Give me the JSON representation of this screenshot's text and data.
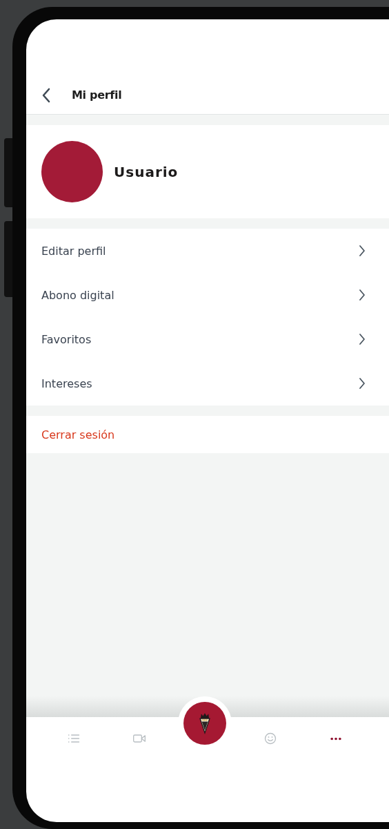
{
  "header": {
    "title": "Mi perfil"
  },
  "profile": {
    "name": "Usuario"
  },
  "menu": [
    {
      "label": "Editar perfil"
    },
    {
      "label": "Abono digital"
    },
    {
      "label": "Favoritos"
    },
    {
      "label": "Intereses"
    }
  ],
  "logout": {
    "label": "Cerrar sesión"
  },
  "bottom_nav": [
    {
      "kind": "list",
      "selected": false
    },
    {
      "kind": "video",
      "selected": false
    },
    {
      "kind": "crest",
      "selected": false
    },
    {
      "kind": "smile",
      "selected": false
    },
    {
      "kind": "more",
      "selected": true
    }
  ]
}
